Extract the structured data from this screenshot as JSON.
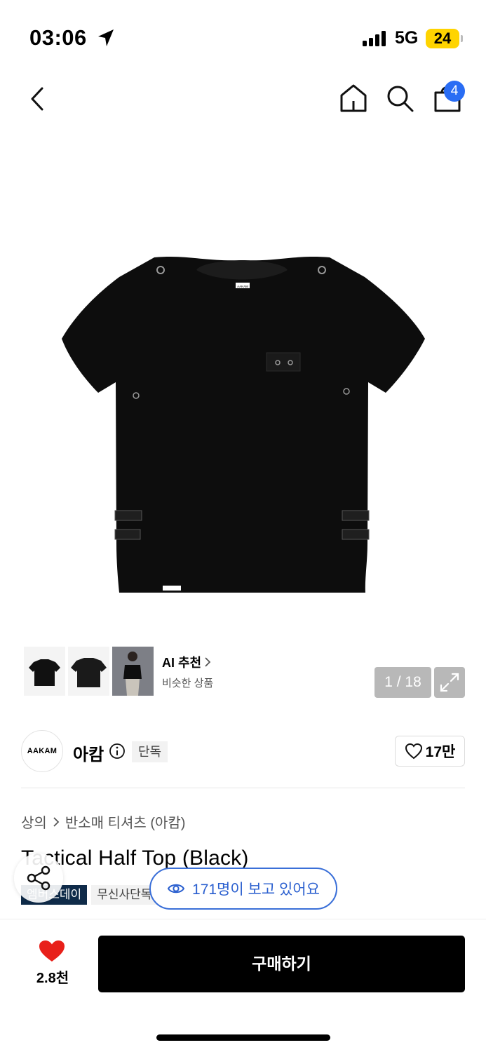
{
  "status_bar": {
    "time": "03:06",
    "network": "5G",
    "battery": "24"
  },
  "nav": {
    "cart_count": "4"
  },
  "gallery": {
    "ai_title": "AI 추천",
    "ai_subtitle": "비슷한 상품",
    "page_counter": "1 / 18",
    "product_label": "AAKAM"
  },
  "brand": {
    "logo_text": "AAKAM",
    "name": "아캄",
    "exclusive_badge": "단독",
    "likes": "17만"
  },
  "breadcrumb": {
    "category": "상의",
    "subcategory": "반소매 티셔츠 (아캄)"
  },
  "product": {
    "title": "Tactical Half Top (Black)",
    "tags": [
      "엠버스데이",
      "무신사단독"
    ]
  },
  "viewing": {
    "text": "171명이 보고 있어요"
  },
  "bottom_bar": {
    "wishlist_count": "2.8천",
    "buy_label": "구매하기"
  },
  "colors": {
    "accent_blue": "#2a5fcf",
    "badge_blue": "#2a6df4",
    "tag_navy": "#0f2b49",
    "heart_red": "#e8201a"
  }
}
